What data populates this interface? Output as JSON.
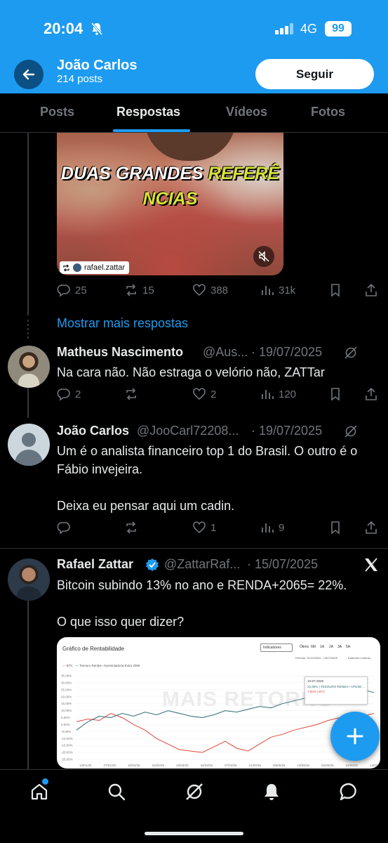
{
  "status_bar": {
    "time": "20:04",
    "network": "4G",
    "battery": "99"
  },
  "header": {
    "name": "João Carlos",
    "subtitle": "214 posts",
    "follow_label": "Seguir"
  },
  "tabs": [
    {
      "label": "Posts"
    },
    {
      "label": "Respostas",
      "active": true
    },
    {
      "label": "Vídeos"
    },
    {
      "label": "Fotos"
    }
  ],
  "video_post": {
    "caption_part1": "DUAS GRANDES ",
    "caption_highlight1": "REFERÊ",
    "caption_highlight2": "NCIAS",
    "repost_user": "rafael.zattar",
    "actions": {
      "replies": "25",
      "reposts": "15",
      "likes": "388",
      "views": "31k"
    }
  },
  "show_more": "Mostrar mais respostas",
  "replies": [
    {
      "name": "Matheus Nascimento",
      "handle": "@Aus...",
      "date": "· 19/07/2025",
      "text": "Na cara não. Não estraga o velório não, ZATTar",
      "actions": {
        "replies": "2",
        "reposts": "",
        "likes": "2",
        "views": "120"
      }
    },
    {
      "name": "João Carlos",
      "handle": "@JooCarl72208...",
      "date": "· 19/07/2025",
      "text": "Um é o analista financeiro top 1 do Brasil. O outro é o Fábio invejeira.\n\nDeixa eu pensar aqui um cadin.",
      "actions": {
        "replies": "",
        "reposts": "",
        "likes": "1",
        "views": "9"
      }
    },
    {
      "name": "Rafael Zattar",
      "handle": "@ZattarRaf...",
      "date": "· 15/07/2025",
      "text": "Bitcoin subindo 13% no ano e RENDA+2065= 22%.\n\nO que isso quer dizer?"
    }
  ],
  "chart_card": {
    "title": "Gráfico de Rentabilidade",
    "indicators_label": "Indicadores",
    "ranges": [
      "Ótimo",
      "6M",
      "1A",
      "2A",
      "3A",
      "5A"
    ],
    "period": "Período: 31/12/2024 - 13/07/2025",
    "calc_label": "Entenda o cálculo",
    "legend": [
      "BTC",
      "Tesouro Renda+ Aposentadoria Extra 2065"
    ],
    "tooltip_date": "10-07-2025",
    "tooltip_rows": [
      "22,95% | TESOURO RENDA+ APOSE...",
      "7,80% | BTC"
    ],
    "watermark": "MAIS RETORNO",
    "colors": {
      "tesouro": "#2e6b73",
      "btc": "#e0463a"
    }
  },
  "chart_data": {
    "type": "line",
    "title": "Gráfico de Rentabilidade",
    "x_ticks": [
      "13/01/25",
      "27/01/25",
      "10/02/25",
      "24/02/25",
      "10/03/25",
      "24/03/25",
      "07/04/25",
      "21/04/25",
      "05/05/25",
      "19/05/25",
      "02/06/25",
      "16/06/25",
      "14/07/25"
    ],
    "y_ticks": [
      "35.00%",
      "30.00%",
      "25.00%",
      "20.00%",
      "15.00%",
      "10.00%",
      "5.00%",
      "0.00%",
      "-5.00%",
      "-10.00%",
      "-15.00%",
      "-20.00%",
      "-25.00%"
    ],
    "ylim": [
      -25,
      35
    ],
    "series": [
      {
        "name": "BTC",
        "values": [
          2,
          4,
          3,
          8,
          5,
          0,
          -4,
          -10,
          -14,
          -18,
          -19,
          -20,
          -16,
          -12,
          -17,
          -19,
          -14,
          -9,
          -7,
          -4,
          -2,
          0,
          3,
          5,
          4,
          6,
          8
        ]
      },
      {
        "name": "Tesouro Renda+ Aposentadoria Extra 2065",
        "values": [
          -4,
          2,
          6,
          5,
          8,
          6,
          9,
          7,
          10,
          8,
          6,
          5,
          7,
          10,
          9,
          11,
          13,
          12,
          15,
          17,
          19,
          20,
          22,
          24,
          23,
          25,
          23
        ]
      }
    ]
  },
  "fab_icon": "plus-icon",
  "bottom_nav": [
    "home-icon",
    "search-icon",
    "grok-icon",
    "notifications-icon",
    "messages-icon"
  ]
}
